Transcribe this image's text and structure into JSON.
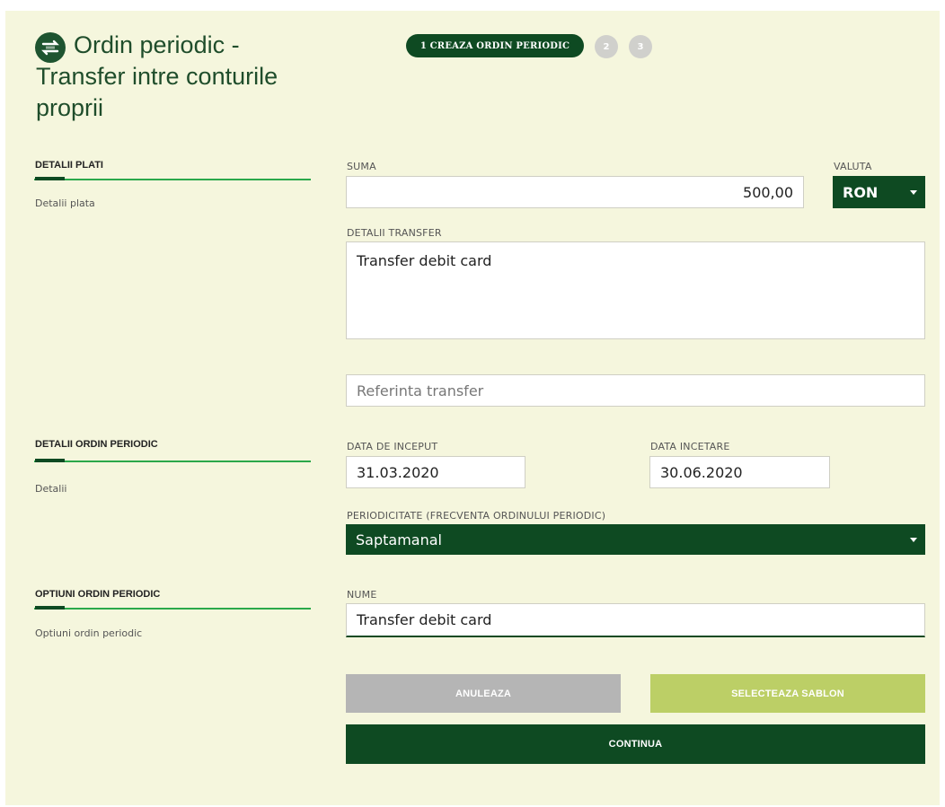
{
  "header": {
    "title": "Ordin periodic - Transfer intre conturile proprii",
    "icon": "transfer-icon"
  },
  "steps": {
    "active_label": "1 CREAZA ORDIN PERIODIC",
    "step2": "2",
    "step3": "3"
  },
  "sections": {
    "plati": {
      "title": "DETALII PLATI",
      "subtitle": "Detalii plata"
    },
    "ordin": {
      "title": "DETALII ORDIN PERIODIC",
      "subtitle": "Detalii"
    },
    "optiuni": {
      "title": "OPTIUNI ORDIN PERIODIC",
      "subtitle": "Optiuni ordin periodic"
    }
  },
  "form": {
    "suma_label": "SUMA",
    "suma_value": "500,00",
    "valuta_label": "VALUTA",
    "valuta_value": "RON",
    "detalii_label": "DETALII TRANSFER",
    "detalii_value": "Transfer debit card",
    "referinta_placeholder": "Referinta transfer",
    "data_inceput_label": "DATA DE INCEPUT",
    "data_inceput_value": "31.03.2020",
    "data_incetare_label": "DATA INCETARE",
    "data_incetare_value": "30.06.2020",
    "periodicitate_label": "PERIODICITATE (FRECVENTA ORDINULUI PERIODIC)",
    "periodicitate_value": "Saptamanal",
    "nume_label": "NUME",
    "nume_value": "Transfer debit card"
  },
  "buttons": {
    "anuleaza": "ANULEAZA",
    "selecteaza": "SELECTEAZA SABLON",
    "continua": "CONTINUA"
  },
  "colors": {
    "background": "#f5f6dd",
    "primary_dark": "#0e4a22",
    "accent_green": "#2aa84a",
    "disabled_gray": "#b5b5b5",
    "light_green": "#bccf66"
  }
}
